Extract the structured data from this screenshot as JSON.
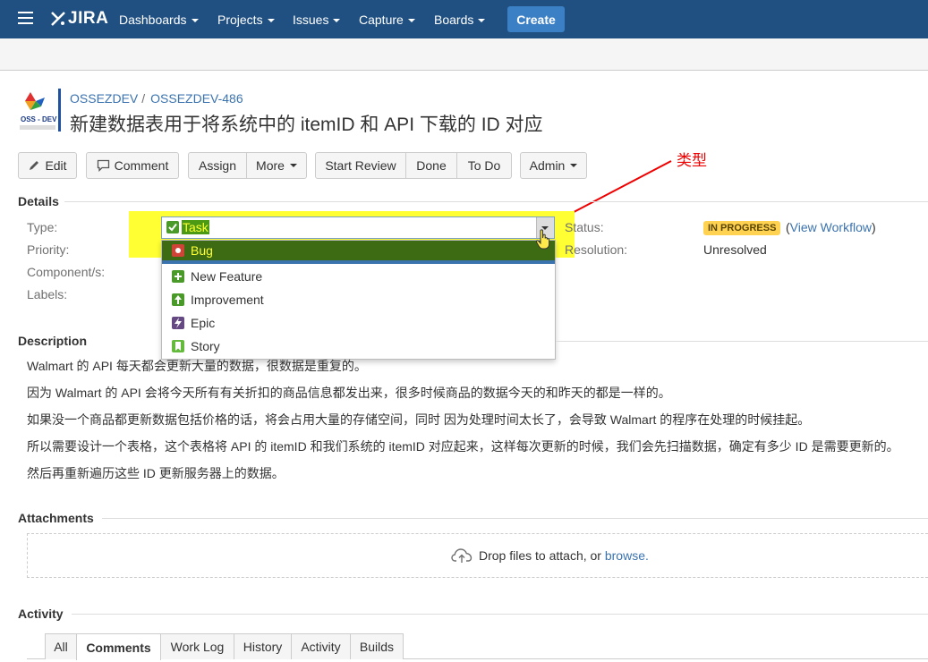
{
  "nav": {
    "logo_text": "JIRA",
    "items": [
      "Dashboards",
      "Projects",
      "Issues",
      "Capture",
      "Boards"
    ],
    "create_label": "Create"
  },
  "project": {
    "avatar_text": "OSS - DEV",
    "breadcrumb_project": "OSSEZDEV",
    "breadcrumb_sep": "/",
    "breadcrumb_issue": "OSSEZDEV-486",
    "title": "新建数据表用于将系统中的 itemID 和 API 下载的 ID 对应"
  },
  "toolbar": {
    "edit": "Edit",
    "comment": "Comment",
    "assign": "Assign",
    "more": "More",
    "start_review": "Start Review",
    "done": "Done",
    "todo": "To Do",
    "admin": "Admin"
  },
  "details": {
    "heading": "Details",
    "type_label": "Type:",
    "priority_label": "Priority:",
    "components_label": "Component/s:",
    "labels_label": "Labels:",
    "type_value": "Task",
    "type_options": [
      "Bug",
      "New Feature",
      "Improvement",
      "Epic",
      "Story"
    ],
    "status_label": "Status:",
    "status_value": "IN PROGRESS",
    "view_workflow_pre": "(",
    "view_workflow": "View Workflow",
    "view_workflow_post": ")",
    "resolution_label": "Resolution:",
    "resolution_value": "Unresolved"
  },
  "annotation": {
    "text": "类型",
    "color": "#ee0000"
  },
  "description": {
    "heading": "Description",
    "lines": [
      "Walmart 的 API 每天都会更新大量的数据，很数据是重复的。",
      "因为 Walmart 的 API 会将今天所有有关折扣的商品信息都发出来，很多时候商品的数据今天的和昨天的都是一样的。",
      "如果没一个商品都更新数据包括价格的话，将会占用大量的存储空间，同时 因为处理时间太长了，会导致 Walmart 的程序在处理的时候挂起。",
      "所以需要设计一个表格，这个表格将 API 的 itemID 和我们系统的 itemID 对应起来，这样每次更新的时候，我们会先扫描数据，确定有多少 ID 是需要更新的。",
      "然后再重新遍历这些 ID 更新服务器上的数据。"
    ]
  },
  "attachments": {
    "heading": "Attachments",
    "drop_text": "Drop files to attach, or",
    "browse": "browse."
  },
  "activity": {
    "heading": "Activity",
    "tabs": [
      "All",
      "Comments",
      "Work Log",
      "History",
      "Activity",
      "Builds"
    ],
    "active_tab": "Comments"
  },
  "colors": {
    "nav_bg": "#205081",
    "create_bg": "#3b7fc4",
    "link": "#3b73af",
    "highlight": "#ffff33",
    "status_bg": "#ffd351"
  }
}
